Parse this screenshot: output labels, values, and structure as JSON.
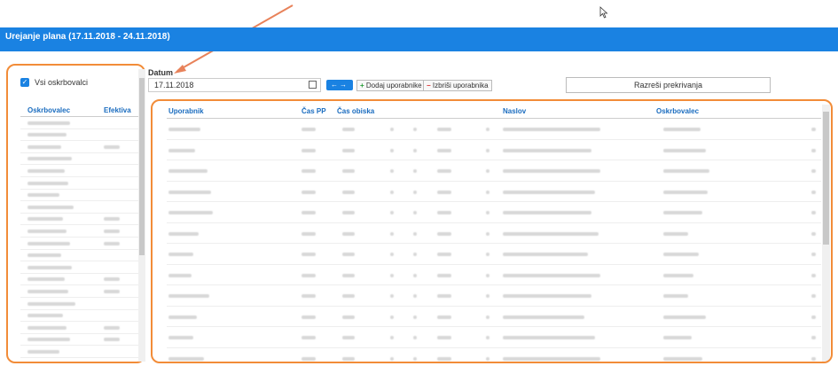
{
  "header": {
    "title": "Urejanje plana (17.11.2018 - 24.11.2018)"
  },
  "left": {
    "checkbox_label": "Vsi oskrbovalci",
    "columns": [
      "Oskrbovalec",
      "Efektiva"
    ],
    "row_count": 21
  },
  "toolbar": {
    "date_label": "Datum",
    "date_value": "17.11.2018",
    "add_label": "Dodaj uporabnike",
    "delete_label": "Izbriši uporabnika",
    "resolve_label": "Razreši prekrivanja"
  },
  "main": {
    "columns": {
      "uporabnik": "Uporabnik",
      "cas_pp": "Čas PP",
      "cas_obiska": "Čas obiska",
      "naslov": "Naslov",
      "oskrbovalec": "Oskrbovalec"
    },
    "row_count": 12
  },
  "colors": {
    "accent": "#1a82e2",
    "highlight": "#f28c38"
  }
}
